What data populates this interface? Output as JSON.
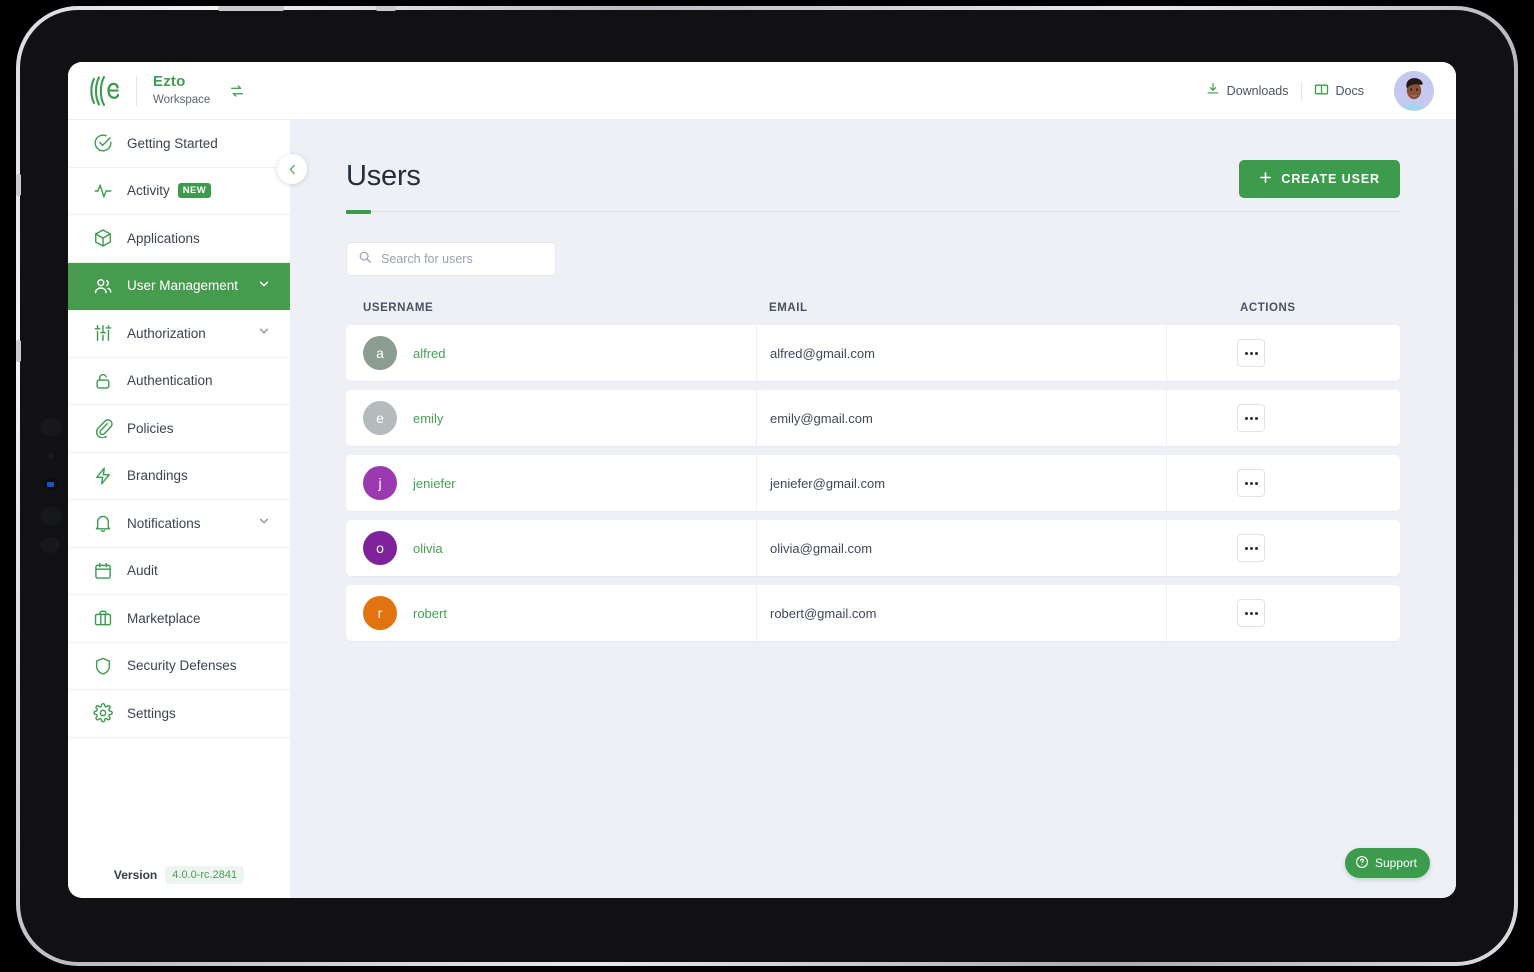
{
  "brand": {
    "name": "Ezto",
    "subtitle": "Workspace",
    "logo_icon": "ezto-logo-icon",
    "swap_icon": "swap-workspace-icon"
  },
  "topbar": {
    "downloads_label": "Downloads",
    "downloads_icon": "download-icon",
    "docs_label": "Docs",
    "docs_icon": "book-icon",
    "avatar_icon": "user-avatar"
  },
  "sidebar": {
    "collapse_icon": "chevron-left-icon",
    "items": [
      {
        "label": "Getting Started",
        "icon": "check-circle-icon",
        "active": false,
        "badge": null,
        "chevron": false
      },
      {
        "label": "Activity",
        "icon": "activity-pulse-icon",
        "active": false,
        "badge": "NEW",
        "chevron": false
      },
      {
        "label": "Applications",
        "icon": "package-icon",
        "active": false,
        "badge": null,
        "chevron": false
      },
      {
        "label": "User Management",
        "icon": "users-icon",
        "active": true,
        "badge": null,
        "chevron": true
      },
      {
        "label": "Authorization",
        "icon": "sliders-icon",
        "active": false,
        "badge": null,
        "chevron": true
      },
      {
        "label": "Authentication",
        "icon": "unlock-icon",
        "active": false,
        "badge": null,
        "chevron": false
      },
      {
        "label": "Policies",
        "icon": "paperclip-icon",
        "active": false,
        "badge": null,
        "chevron": false
      },
      {
        "label": "Brandings",
        "icon": "bolt-icon",
        "active": false,
        "badge": null,
        "chevron": false
      },
      {
        "label": "Notifications",
        "icon": "bell-icon",
        "active": false,
        "badge": null,
        "chevron": true
      },
      {
        "label": "Audit",
        "icon": "calendar-icon",
        "active": false,
        "badge": null,
        "chevron": false
      },
      {
        "label": "Marketplace",
        "icon": "briefcase-icon",
        "active": false,
        "badge": null,
        "chevron": false
      },
      {
        "label": "Security Defenses",
        "icon": "shield-icon",
        "active": false,
        "badge": null,
        "chevron": false
      },
      {
        "label": "Settings",
        "icon": "gear-icon",
        "active": false,
        "badge": null,
        "chevron": false
      }
    ],
    "version_label": "Version",
    "version_value": "4.0.0-rc.2841"
  },
  "main": {
    "title": "Users",
    "create_button": "CREATE USER",
    "create_icon": "plus-icon",
    "search": {
      "placeholder": "Search for users",
      "value": "",
      "icon": "search-icon"
    },
    "table": {
      "columns": [
        "USERNAME",
        "EMAIL",
        "ACTIONS"
      ],
      "rows": [
        {
          "initial": "a",
          "username": "alfred",
          "email": "alfred@gmail.com",
          "avatar_color": "#8b9d90"
        },
        {
          "initial": "e",
          "username": "emily",
          "email": "emily@gmail.com",
          "avatar_color": "#b5babd"
        },
        {
          "initial": "j",
          "username": "jeniefer",
          "email": "jeniefer@gmail.com",
          "avatar_color": "#9b39b0"
        },
        {
          "initial": "o",
          "username": "olivia",
          "email": "olivia@gmail.com",
          "avatar_color": "#7e239b"
        },
        {
          "initial": "r",
          "username": "robert",
          "email": "robert@gmail.com",
          "avatar_color": "#e2730f"
        }
      ],
      "action_icon": "more-options-icon"
    }
  },
  "support": {
    "label": "Support",
    "icon": "help-circle-icon"
  },
  "colors": {
    "brand_green": "#3d9b4e",
    "active_green": "#469b4f",
    "page_bg": "#eef0f5",
    "text_dark": "#262d3d"
  }
}
